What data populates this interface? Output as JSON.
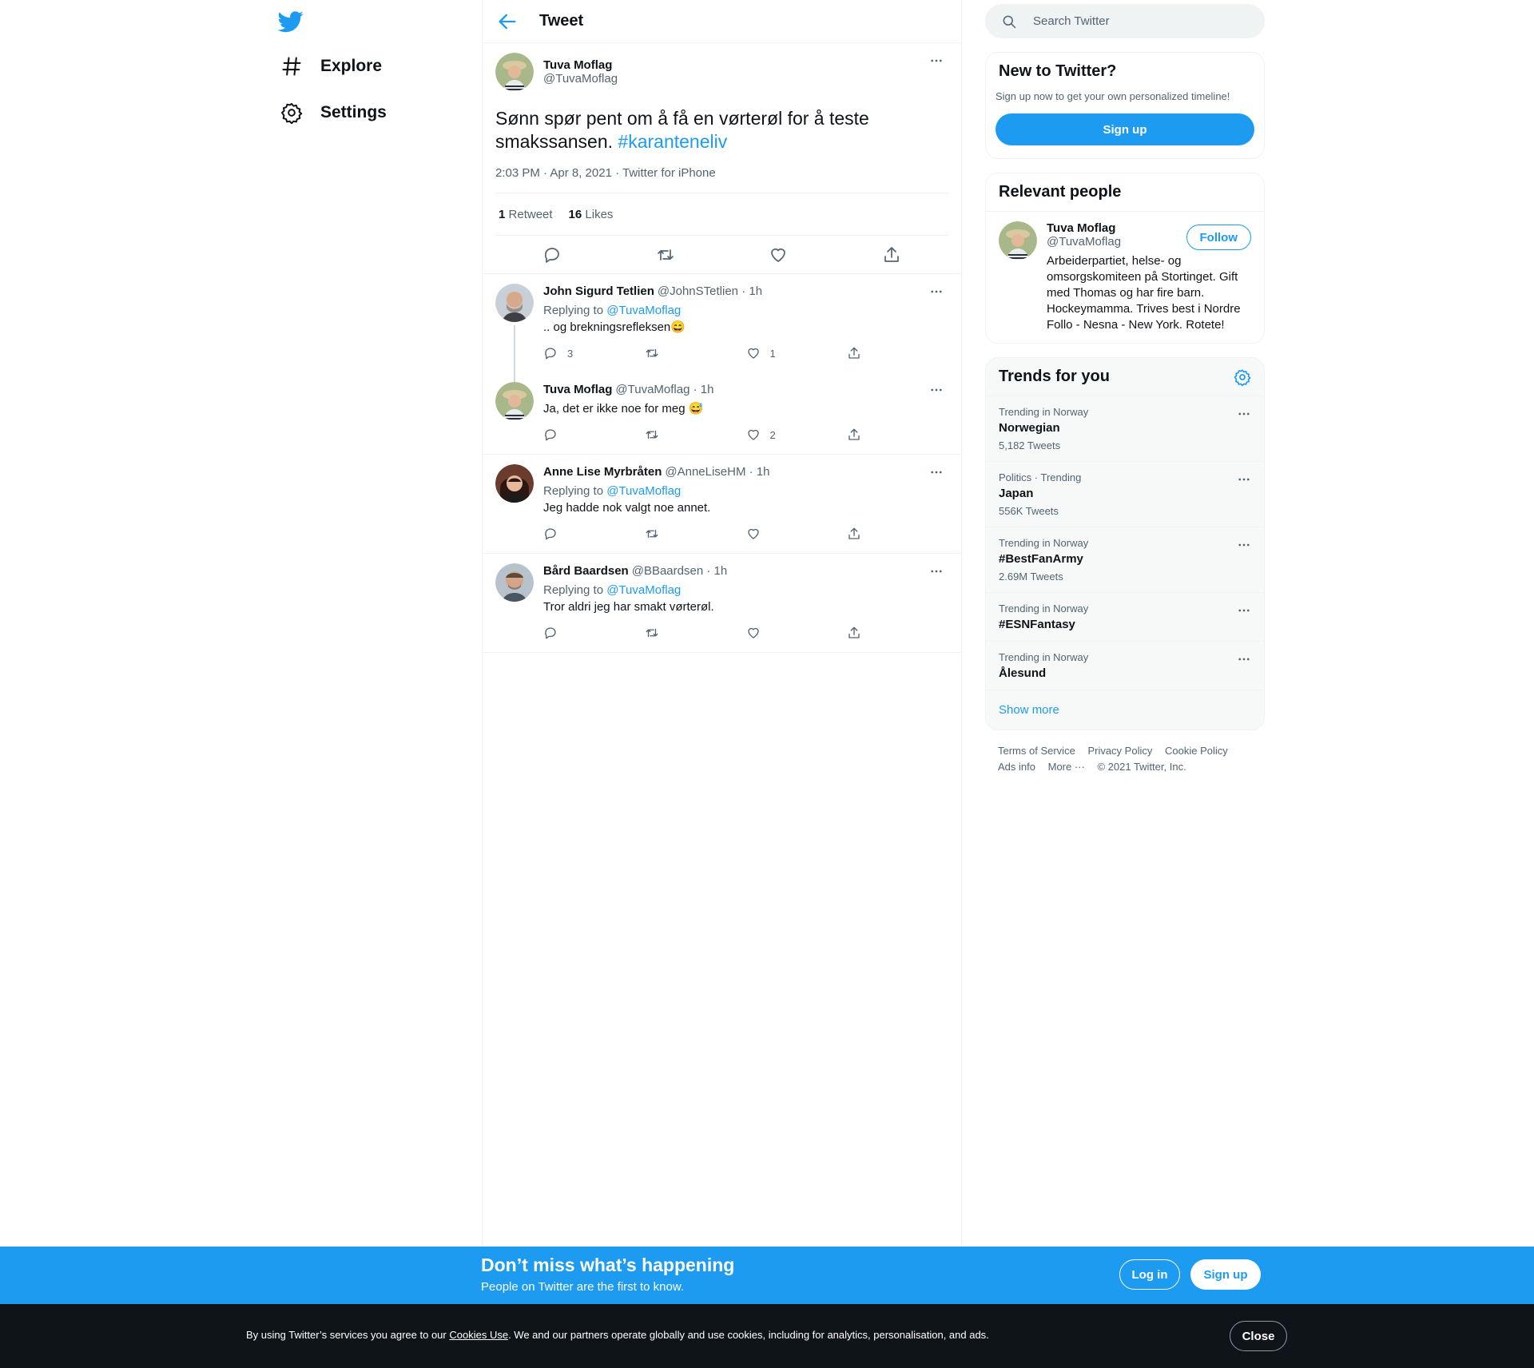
{
  "nav": {
    "items": [
      {
        "label": "Explore",
        "icon": "hashtag-icon"
      },
      {
        "label": "Settings",
        "icon": "gear-icon"
      }
    ]
  },
  "header": {
    "title": "Tweet"
  },
  "focus_tweet": {
    "name": "Tuva Moflag",
    "handle": "@TuvaMoflag",
    "text": "Sønn spør pent om å få en vørterøl for å teste smakssansen. ",
    "hashtag": "#karanteneliv",
    "meta": "2:03 PM · Apr 8, 2021 · Twitter for iPhone",
    "retweets_count": "1",
    "retweets_label": "Retweet",
    "likes_count": "16",
    "likes_label": "Likes"
  },
  "replies": [
    {
      "name": "John Sigurd Tetlien",
      "handle": "@JohnSTetlien",
      "time": "· 1h",
      "replying_prefix": "Replying to ",
      "replying_to": "@TuvaMoflag",
      "text": ".. og brekningsrefleksen😄",
      "reply_count": "3",
      "retweet_count": "",
      "like_count": "1"
    },
    {
      "name": "Tuva Moflag",
      "handle": "@TuvaMoflag",
      "time": "· 1h",
      "replying_prefix": "",
      "replying_to": "",
      "text": "Ja, det er ikke noe for meg 😅",
      "reply_count": "",
      "retweet_count": "",
      "like_count": "2"
    },
    {
      "name": "Anne Lise Myrbråten",
      "handle": "@AnneLiseHM",
      "time": "· 1h",
      "replying_prefix": "Replying to ",
      "replying_to": "@TuvaMoflag",
      "text": "Jeg hadde nok valgt noe annet.",
      "reply_count": "",
      "retweet_count": "",
      "like_count": ""
    },
    {
      "name": "Bård Baardsen",
      "handle": "@BBaardsen",
      "time": "· 1h",
      "replying_prefix": "Replying to ",
      "replying_to": "@TuvaMoflag",
      "text": "Tror aldri jeg har smakt vørterøl.",
      "reply_count": "",
      "retweet_count": "",
      "like_count": ""
    }
  ],
  "search": {
    "placeholder": "Search Twitter"
  },
  "new_to_twitter": {
    "title": "New to Twitter?",
    "subtitle": "Sign up now to get your own personalized timeline!",
    "button": "Sign up"
  },
  "relevant_people": {
    "title": "Relevant people",
    "name": "Tuva Moflag",
    "handle": "@TuvaMoflag",
    "follow": "Follow",
    "bio": "Arbeiderpartiet, helse- og omsorgskomiteen på Stortinget. Gift med Thomas og har fire barn. Hockeymamma. Trives best i Nordre Follo - Nesna - New York. Rotete!"
  },
  "trends": {
    "title": "Trends for you",
    "items": [
      {
        "context": "Trending in Norway",
        "name": "Norwegian",
        "count": "5,182 Tweets"
      },
      {
        "context": "Politics · Trending",
        "name": "Japan",
        "count": "556K Tweets"
      },
      {
        "context": "Trending in Norway",
        "name": "#BestFanArmy",
        "count": "2.69M Tweets"
      },
      {
        "context": "Trending in Norway",
        "name": "#ESNFantasy",
        "count": ""
      },
      {
        "context": "Trending in Norway",
        "name": "Ålesund",
        "count": ""
      }
    ],
    "show_more": "Show more"
  },
  "footer": {
    "links": [
      "Terms of Service",
      "Privacy Policy",
      "Cookie Policy",
      "Ads info",
      "More ···",
      "© 2021 Twitter, Inc."
    ]
  },
  "bottom_bar": {
    "title": "Don’t miss what’s happening",
    "subtitle": "People on Twitter are the first to know.",
    "login": "Log in",
    "signup": "Sign up"
  },
  "cookie_bar": {
    "text_before": "By using Twitter’s services you agree to our ",
    "link": "Cookies Use",
    "text_after": ". We and our partners operate globally and use cookies, including for analytics, personalisation, and ads.",
    "close": "Close"
  },
  "colors": {
    "accent": "#1d9bf0",
    "text": "#0f1419",
    "secondary": "#536471",
    "cookie_bg": "#0f1419"
  }
}
